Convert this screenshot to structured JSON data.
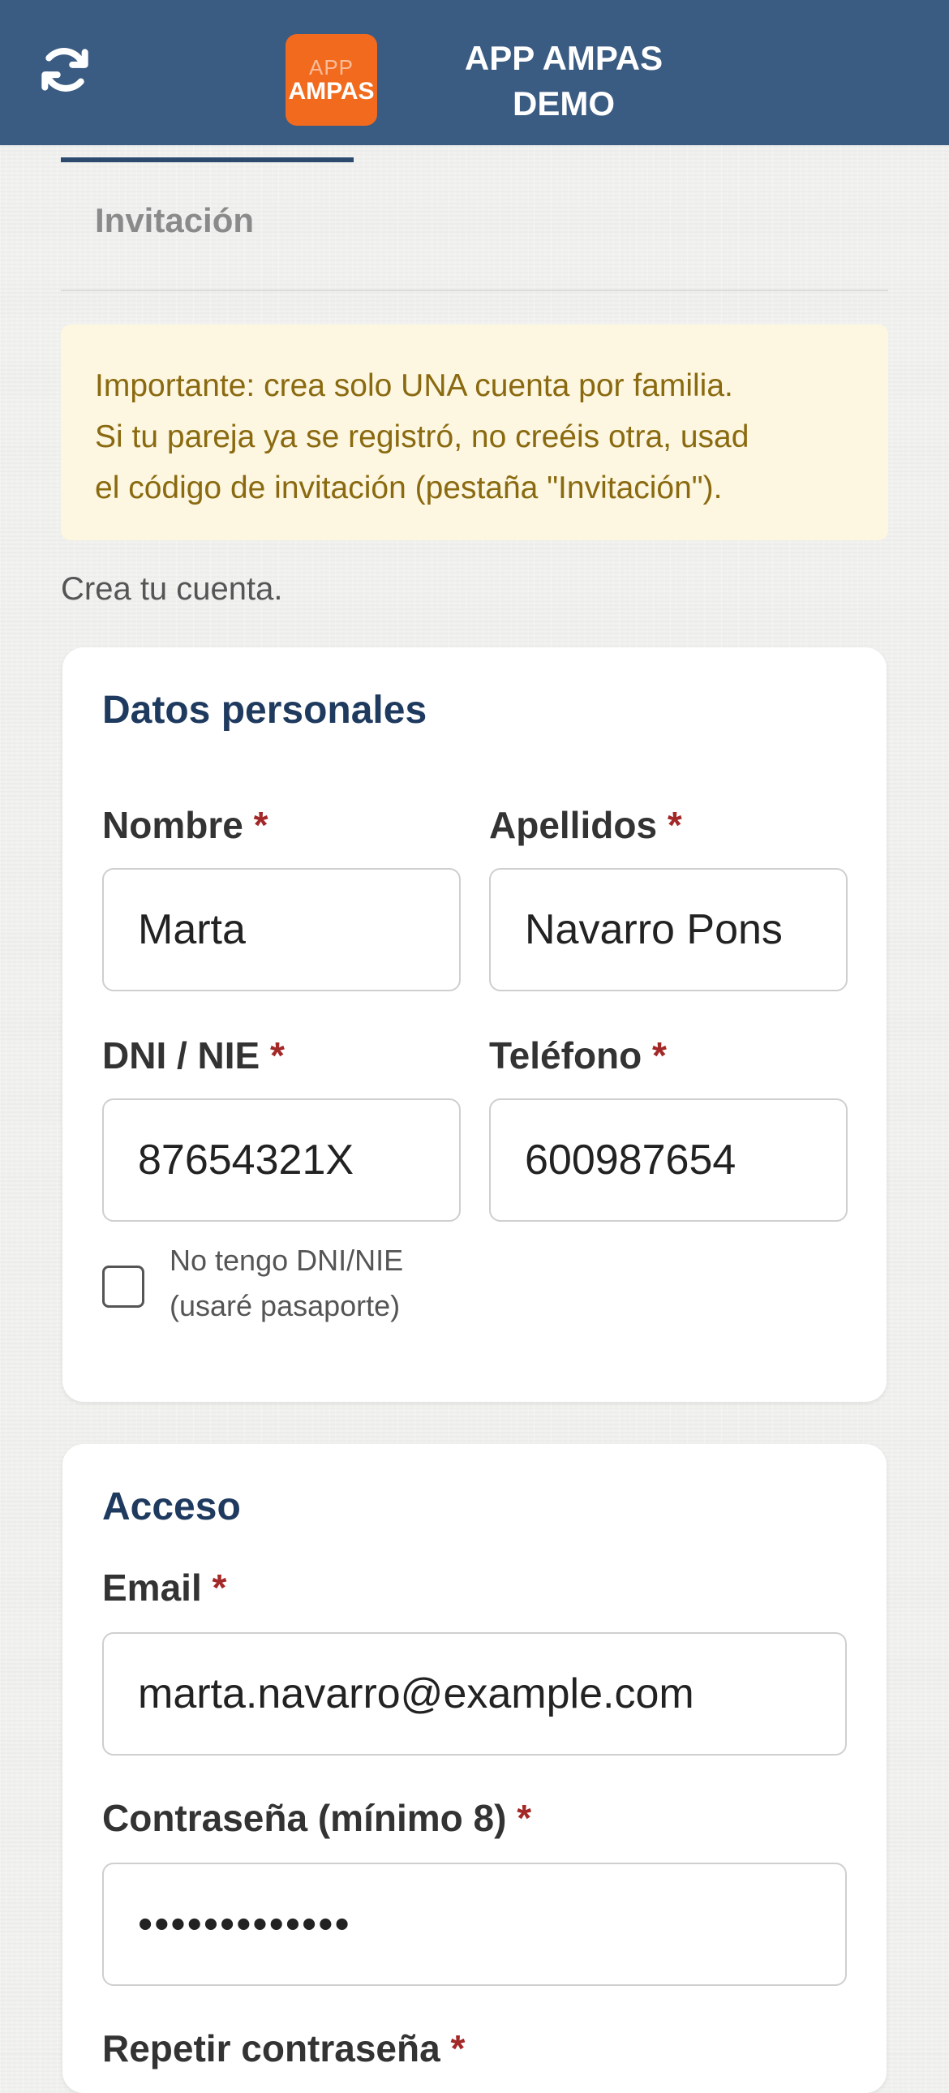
{
  "header": {
    "refresh_icon": "refresh-icon",
    "logo_line1": "APP",
    "logo_line2": "AMPAS",
    "title_line1": "APP AMPAS",
    "title_line2": "DEMO",
    "colors": {
      "bar": "#3a5b82",
      "logo": "#f26a1e"
    }
  },
  "tabs": {
    "invitation_label": "Invitación"
  },
  "notice": {
    "line1": "Importante: crea solo UNA cuenta por familia.",
    "line2": "Si tu pareja ya se registró, no creéis otra, usad",
    "line3": "el código de invitación (pestaña \"Invitación\")."
  },
  "intro": "Crea tu cuenta.",
  "personal": {
    "title": "Datos personales",
    "nombre_label": "Nombre",
    "nombre_value": "Marta",
    "apellidos_label": "Apellidos",
    "apellidos_value": "Navarro Pons",
    "dni_label": "DNI / NIE",
    "dni_value": "87654321X",
    "telefono_label": "Teléfono",
    "telefono_value": "600987654",
    "no_dni_line1": "No tengo DNI/NIE",
    "no_dni_line2": "(usaré pasaporte)",
    "no_dni_checked": false
  },
  "access": {
    "title": "Acceso",
    "email_label": "Email",
    "email_value": "marta.navarro@example.com",
    "password_label": "Contraseña (mínimo 8)",
    "password_value": "•••••••••••••",
    "repeat_label": "Repetir contraseña"
  },
  "required_mark": "*"
}
